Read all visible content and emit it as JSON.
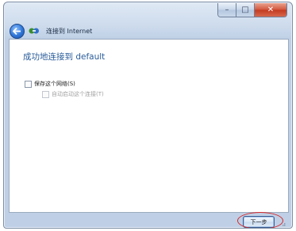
{
  "window": {
    "title": "连接到 Internet",
    "buttons": {
      "minimize": "–",
      "maximize": "□",
      "close": "✕"
    }
  },
  "main": {
    "heading": "成功地连接到 default",
    "options": [
      {
        "label": "保存这个网络(S)",
        "checked": false,
        "enabled": true
      },
      {
        "label": "自动启动这个连接(T)",
        "checked": false,
        "enabled": false
      }
    ]
  },
  "footer": {
    "next_label": "下一步"
  },
  "icons": {
    "back": "back-arrow-icon",
    "network": "network-connection-icon"
  },
  "colors": {
    "heading": "#2a5c9a",
    "highlight": "#d6282a",
    "close_button": "#c23a1f"
  }
}
